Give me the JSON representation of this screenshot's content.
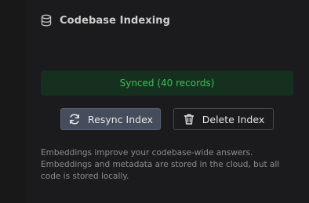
{
  "header": {
    "title": "Codebase Indexing",
    "icon": "database-icon"
  },
  "status": {
    "text": "Synced (40 records)",
    "color": "#3ebf5a",
    "background": "#16301f"
  },
  "actions": {
    "resync_label": "Resync Index",
    "resync_icon": "refresh-icon",
    "delete_label": "Delete Index",
    "delete_icon": "trash-icon"
  },
  "description": "Embeddings improve your codebase-wide answers. Embeddings and metadata are stored in the cloud, but all code is stored locally."
}
